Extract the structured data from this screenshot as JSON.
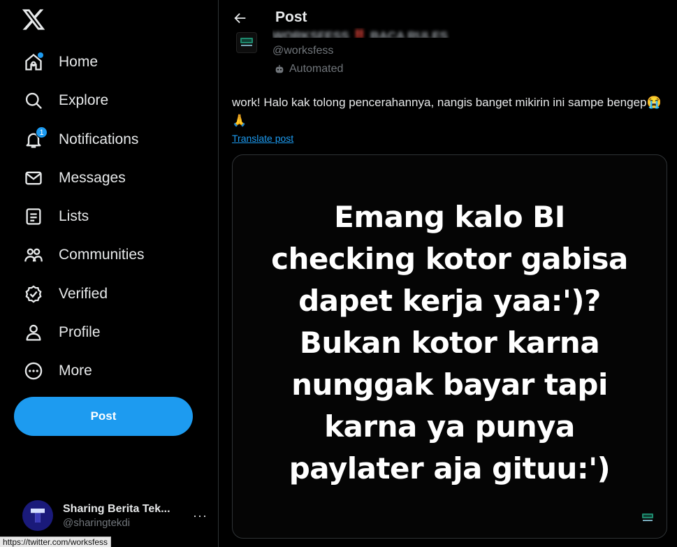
{
  "nav": {
    "items": [
      {
        "label": "Home",
        "icon": "home-icon"
      },
      {
        "label": "Explore",
        "icon": "search-icon"
      },
      {
        "label": "Notifications",
        "icon": "bell-icon",
        "badge": "1"
      },
      {
        "label": "Messages",
        "icon": "envelope-icon"
      },
      {
        "label": "Lists",
        "icon": "list-icon"
      },
      {
        "label": "Communities",
        "icon": "people-icon"
      },
      {
        "label": "Verified",
        "icon": "verified-icon"
      },
      {
        "label": "Profile",
        "icon": "person-icon"
      },
      {
        "label": "More",
        "icon": "more-circle-icon"
      }
    ],
    "post_label": "Post"
  },
  "account": {
    "name": "Sharing Berita Tek...",
    "handle": "@sharingtekdi",
    "more": "···"
  },
  "status_bar": {
    "url": "https://twitter.com/worksfess"
  },
  "header": {
    "title": "Post"
  },
  "tweet": {
    "author_name": "WORKSFESS ‼️ BACA RULES ‼️",
    "handle": "@worksfess",
    "automated_label": "Automated",
    "text": "work! Halo kak tolong pencerahannya, nangis banget mikirin ini sampe bengep😭🙏",
    "translate_label": "Translate post",
    "image_lines": [
      "Emang kalo BI",
      "checking kotor gabisa",
      "dapet kerja yaa:')?",
      "Bukan kotor karna",
      "nunggak bayar tapi",
      "karna ya punya",
      "paylater aja gituu:')"
    ]
  },
  "colors": {
    "accent": "#1d9bf0",
    "background": "#000000",
    "muted": "#71767b"
  }
}
